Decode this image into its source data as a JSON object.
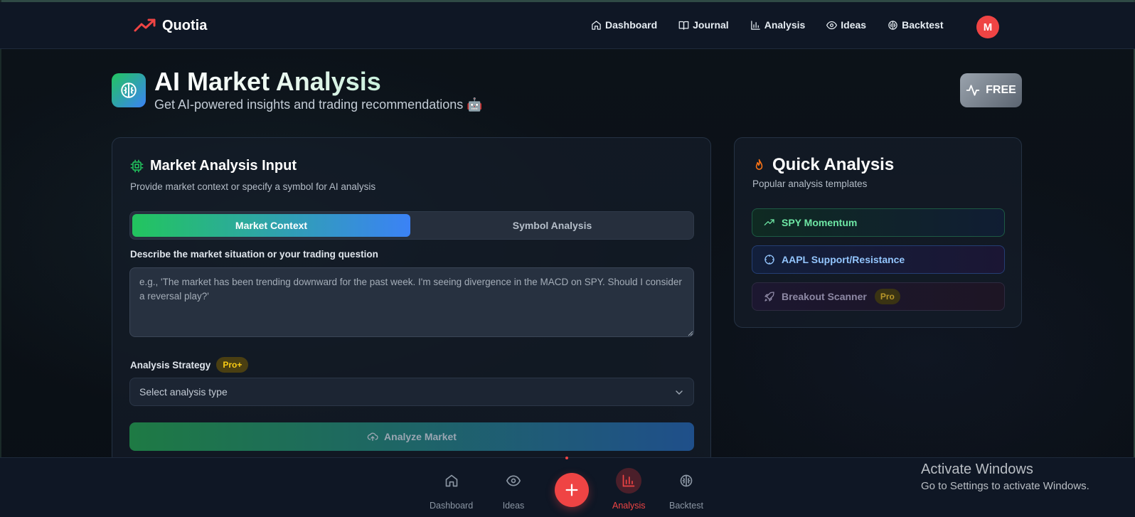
{
  "header": {
    "brand": "Quotia",
    "nav": [
      {
        "label": "Dashboard",
        "icon": "home-icon"
      },
      {
        "label": "Journal",
        "icon": "book-icon"
      },
      {
        "label": "Analysis",
        "icon": "bar-chart-icon"
      },
      {
        "label": "Ideas",
        "icon": "eye-icon"
      },
      {
        "label": "Backtest",
        "icon": "brain-icon"
      }
    ],
    "avatar_initial": "M"
  },
  "page": {
    "title": "AI Market Analysis",
    "subtitle": "Get AI-powered insights and trading recommendations 🤖",
    "plan_badge": "FREE"
  },
  "input_card": {
    "title": "Market Analysis Input",
    "description": "Provide market context or specify a symbol for AI analysis",
    "tabs": [
      {
        "label": "Market Context",
        "active": true
      },
      {
        "label": "Symbol Analysis",
        "active": false
      }
    ],
    "question_label": "Describe the market situation or your trading question",
    "question_placeholder": "e.g., 'The market has been trending downward for the past week. I'm seeing divergence in the MACD on SPY. Should I consider a reversal play?'",
    "strategy_label": "Analysis Strategy",
    "strategy_badge": "Pro+",
    "strategy_select": "Select analysis type",
    "analyze_button": "Analyze Market"
  },
  "quick_card": {
    "title": "Quick Analysis",
    "description": "Popular analysis templates",
    "items": [
      {
        "label": "SPY Momentum",
        "icon": "trending-up-icon"
      },
      {
        "label": "AAPL Support/Resistance",
        "icon": "crosshair-icon"
      },
      {
        "label": "Breakout Scanner",
        "icon": "rocket-icon",
        "badge": "Pro"
      }
    ]
  },
  "bottom_nav": {
    "items": [
      {
        "label": "Dashboard",
        "icon": "home-icon"
      },
      {
        "label": "Ideas",
        "icon": "eye-icon"
      },
      {
        "label": "Analysis",
        "icon": "bar-chart-icon",
        "active": true
      },
      {
        "label": "Backtest",
        "icon": "brain-icon"
      }
    ],
    "fab_icon": "plus-icon"
  },
  "watermark": {
    "line1": "Activate Windows",
    "line2": "Go to Settings to activate Windows."
  },
  "colors": {
    "accent_red": "#ef4444",
    "accent_green": "#22c55e",
    "accent_blue": "#3b82f6",
    "background": "#0b1017"
  }
}
